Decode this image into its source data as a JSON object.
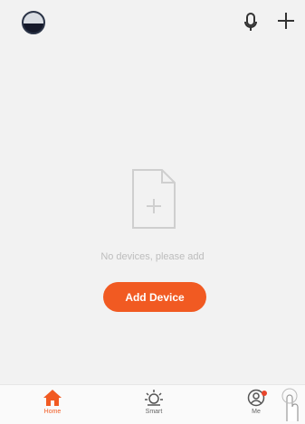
{
  "header": {
    "avatar_icon": "profile-avatar",
    "mic_icon": "microphone-icon",
    "add_icon": "plus-icon"
  },
  "empty_state": {
    "icon": "document-add-icon",
    "message": "No devices, please add",
    "button_label": "Add Device"
  },
  "tabbar": {
    "items": [
      {
        "label": "Home",
        "icon": "home-icon",
        "active": true
      },
      {
        "label": "Smart",
        "icon": "sun-icon",
        "active": false
      },
      {
        "label": "Me",
        "icon": "user-icon",
        "active": false,
        "badge": true
      }
    ]
  },
  "colors": {
    "accent": "#f15a22",
    "background": "#f2f2f2",
    "tabbar": "#fafafa",
    "badge": "#e8452c"
  }
}
